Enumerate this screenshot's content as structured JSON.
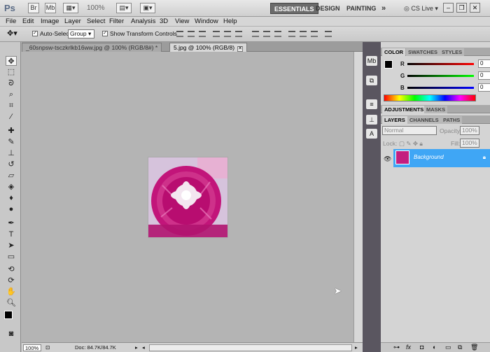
{
  "app": {
    "logo": "Ps"
  },
  "topbar": {
    "zoom": "100%",
    "workspaces": [
      "ESSENTIALS",
      "DESIGN",
      "PAINTING"
    ],
    "more": "»",
    "cs_live": "CS Live"
  },
  "menu": [
    "File",
    "Edit",
    "Image",
    "Layer",
    "Select",
    "Filter",
    "Analysis",
    "3D",
    "View",
    "Window",
    "Help"
  ],
  "options": {
    "auto_select_label": "Auto-Select:",
    "auto_select_value": "Group",
    "show_transform_label": "Show Transform Controls"
  },
  "tabs": [
    {
      "label": "_60snpsw-tsczkrlkb16ww.jpg @ 100% (RGB/8#) *"
    },
    {
      "label": "5.jpg @ 100% (RGB/8)"
    }
  ],
  "status": {
    "zoom": "100%",
    "doc": "Doc: 84.7K/84.7K"
  },
  "panels": {
    "color_tabs": [
      "COLOR",
      "SWATCHES",
      "STYLES"
    ],
    "adjust_tabs": [
      "ADJUSTMENTS",
      "MASKS"
    ],
    "layer_tabs": [
      "LAYERS",
      "CHANNELS",
      "PATHS"
    ],
    "color": {
      "channels": [
        {
          "label": "R",
          "value": "0"
        },
        {
          "label": "G",
          "value": "0"
        },
        {
          "label": "B",
          "value": "0"
        }
      ]
    },
    "layers": {
      "blend_mode": "Normal",
      "opacity_label": "Opacity:",
      "opacity_value": "100%",
      "lock_label": "Lock:",
      "fill_label": "Fill:",
      "fill_value": "100%",
      "layer_name": "Background"
    }
  },
  "colors": {
    "accent": "#3fa6f5",
    "photo_pink": "#c31e7f"
  }
}
